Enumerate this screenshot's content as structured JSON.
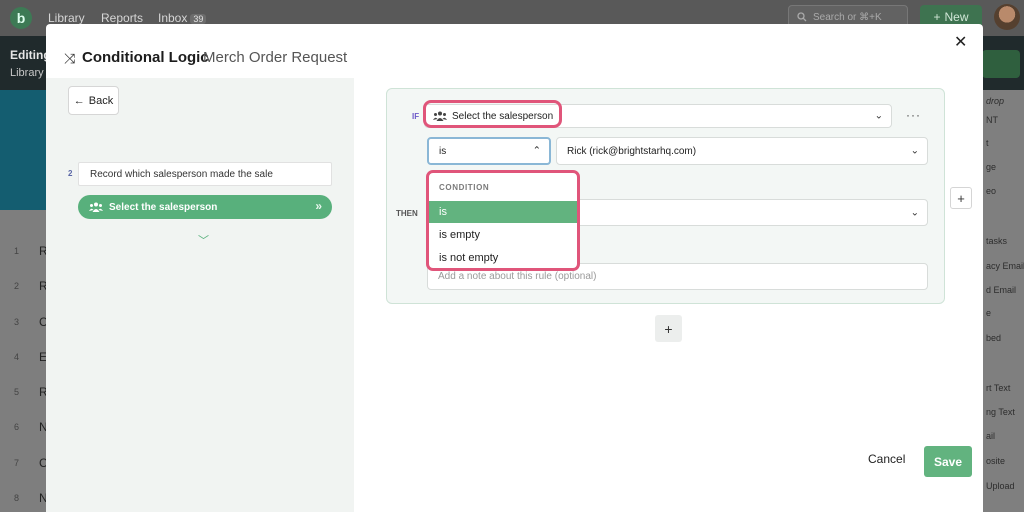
{
  "app": {
    "logo": "b",
    "nav": [
      "Library",
      "Reports",
      "Inbox"
    ],
    "inbox_count": "39",
    "search_placeholder": "Search or ⌘+K",
    "new_label": "New",
    "editing_title": "Editing",
    "editing_sub": "Library",
    "rows": [
      {
        "num": "1",
        "letter": "R"
      },
      {
        "num": "2",
        "letter": "R"
      },
      {
        "num": "3",
        "letter": "C"
      },
      {
        "num": "4",
        "letter": "E"
      },
      {
        "num": "5",
        "letter": "R"
      },
      {
        "num": "6",
        "letter": "N"
      },
      {
        "num": "7",
        "letter": "C"
      },
      {
        "num": "8",
        "letter": "N"
      }
    ],
    "right_panel": [
      "drop",
      "NT",
      "t",
      "ge",
      "eo",
      "tasks",
      "acy Email",
      "d Email",
      "e",
      "bed",
      "rt Text",
      "ng Text",
      "ail",
      "osite",
      "Upload"
    ]
  },
  "modal": {
    "title": "Conditional Logic",
    "subtitle": "Merch Order Request",
    "back_label": "Back",
    "step_number": "2",
    "step_text": "Record which salesperson made the sale",
    "step_pill": "Select the salesperson",
    "if_label": "IF",
    "then_label": "THEN",
    "if_field": "Select the salesperson",
    "condition_value": "is",
    "value_field": "Rick (rick@brightstarhq.com)",
    "note_placeholder": "Add a note about this rule (optional)",
    "dropdown": {
      "header": "CONDITION",
      "options": [
        "is",
        "is empty",
        "is not empty"
      ],
      "selected": "is"
    },
    "cancel_label": "Cancel",
    "save_label": "Save"
  },
  "colors": {
    "accent_green": "#62b37f",
    "highlight_pink": "#e0557a",
    "if_purple": "#6d5ac9"
  }
}
